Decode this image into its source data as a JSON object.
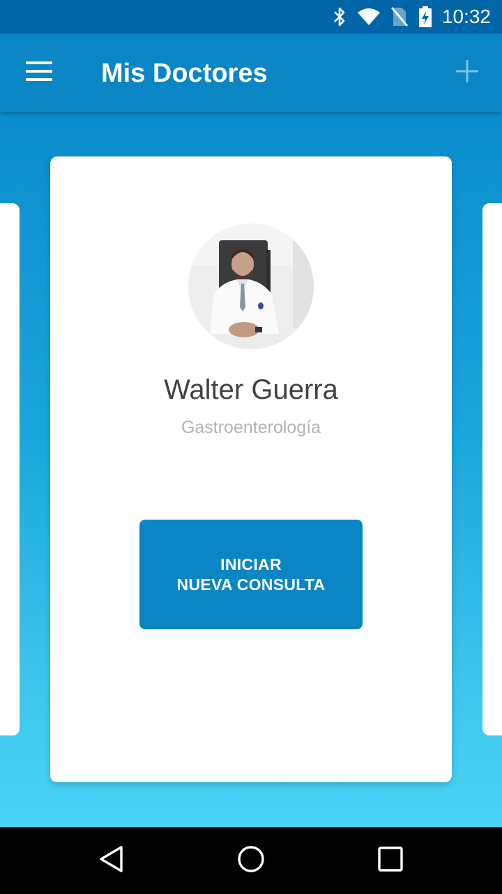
{
  "status_bar": {
    "time": "10:32",
    "icons": [
      "bluetooth-icon",
      "wifi-icon",
      "no-sim-icon",
      "battery-charging-icon"
    ]
  },
  "app_bar": {
    "title": "Mis Doctores",
    "menu_icon": "menu-icon",
    "add_icon": "add-icon"
  },
  "doctor": {
    "name": "Walter Guerra",
    "specialty": "Gastroenterología",
    "photo": "doctor-photo",
    "button_line1": "INICIAR",
    "button_line2": "NUEVA CONSULTA"
  },
  "nav_bar": {
    "icons": [
      "back-icon",
      "home-icon",
      "recents-icon"
    ]
  },
  "colors": {
    "primary": "#0a86c4",
    "status_bar": "#0066a8",
    "gradient_top": "#0b8dcc",
    "gradient_bottom": "#48d4f6",
    "name_text": "#424242",
    "specialty_text": "#b3b3b3"
  }
}
